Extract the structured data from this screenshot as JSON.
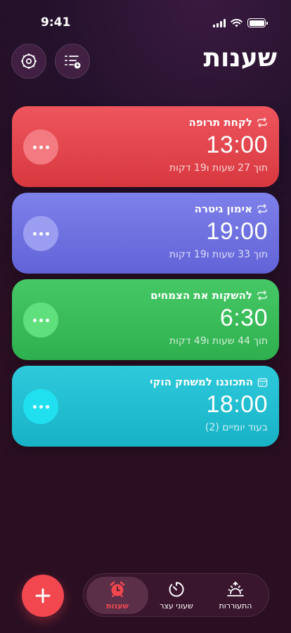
{
  "status_bar": {
    "time": "9:41"
  },
  "header": {
    "title": "שענות",
    "settings_icon": "gear-icon",
    "list_icon": "list-clock-icon"
  },
  "alarms": [
    {
      "label": "לקחת תרופה",
      "time": "13:00",
      "remaining": "תוך 27 שעות ו19 דקות",
      "icon": "repeat-icon",
      "color": "#e9464f"
    },
    {
      "label": "אימון גיטרה",
      "time": "19:00",
      "remaining": "תוך 33 שעות ו19 דקות",
      "icon": "repeat-icon",
      "color": "#6f70e0"
    },
    {
      "label": "להשקות את הצמחים",
      "time": "6:30",
      "remaining": "תוך 44 שעות ו49 דקות",
      "icon": "repeat-icon",
      "color": "#38c05a"
    },
    {
      "label": "התכוננו למשחק הוקי",
      "time": "18:00",
      "remaining": "בעוד יומיים (2)",
      "icon": "calendar-icon",
      "color": "#22c0d2"
    }
  ],
  "fab": {
    "icon": "plus-icon"
  },
  "tabs": [
    {
      "label": "שענות",
      "icon": "alarm-clock-icon",
      "active": true
    },
    {
      "label": "שעוני עצר",
      "icon": "timer-icon",
      "active": false
    },
    {
      "label": "התעוררות",
      "icon": "sunrise-icon",
      "active": false
    }
  ],
  "colors": {
    "accent": "#f2474f"
  }
}
